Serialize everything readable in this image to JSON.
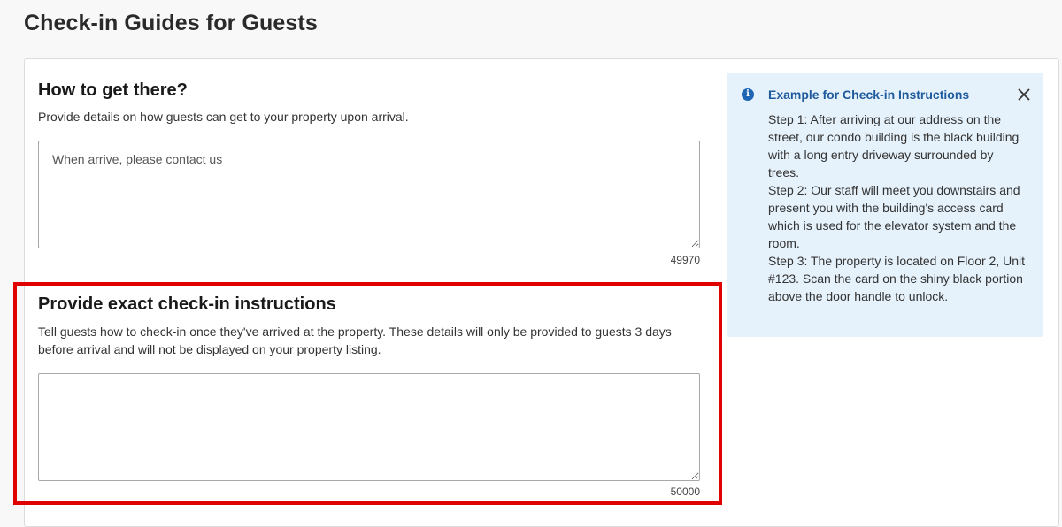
{
  "page": {
    "title": "Check-in Guides for Guests"
  },
  "how_to_get_there": {
    "title": "How to get there?",
    "description": "Provide details on how guests can get to your property upon arrival.",
    "value": "",
    "placeholder": "When arrive, please contact us",
    "counter": "49970"
  },
  "checkin_instructions": {
    "title": "Provide exact check-in instructions",
    "description": "Tell guests how to check-in once they've arrived at the property. These details will only be provided to guests 3 days before arrival and will not be displayed on your property listing.",
    "value": "",
    "placeholder": "",
    "counter": "50000"
  },
  "example_panel": {
    "icon": "info-icon",
    "title": "Example for Check-in Instructions",
    "close_icon": "close-icon",
    "steps": [
      "Step 1: After arriving at our address on the street, our condo building is the black building with a long entry driveway surrounded by trees.",
      "Step 2: Our staff will meet you downstairs and present you with the building's access card which is used for the elevator system and the room.",
      "Step 3: The property is located on Floor 2, Unit #123. Scan the card on the shiny black portion above the door handle to unlock."
    ]
  },
  "colors": {
    "highlight": "#e00000",
    "panel_bg": "#e6f2fb",
    "accent": "#1e5a9c"
  }
}
